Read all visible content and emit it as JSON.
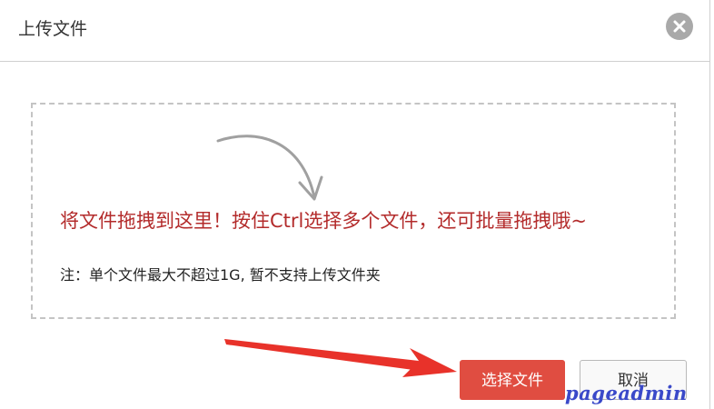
{
  "dialog": {
    "title": "上传文件",
    "close_icon": "close-icon"
  },
  "dropzone": {
    "message": "将文件拖拽到这里！按住Ctrl选择多个文件，还可批量拖拽哦~",
    "note": "注：单个文件最大不超过1G, 暂不支持上传文件夹",
    "hint_icon": "curved-arrow-icon"
  },
  "buttons": {
    "select_files": "选择文件",
    "cancel": "取消"
  },
  "annotation": {
    "pointer_icon": "red-arrow-icon"
  },
  "watermark": {
    "text": "pageadmin"
  },
  "colors": {
    "primary": "#e04d41",
    "message_text": "#b32b2b",
    "annotation_arrow": "#e8322a",
    "watermark": "#3a49c9"
  }
}
